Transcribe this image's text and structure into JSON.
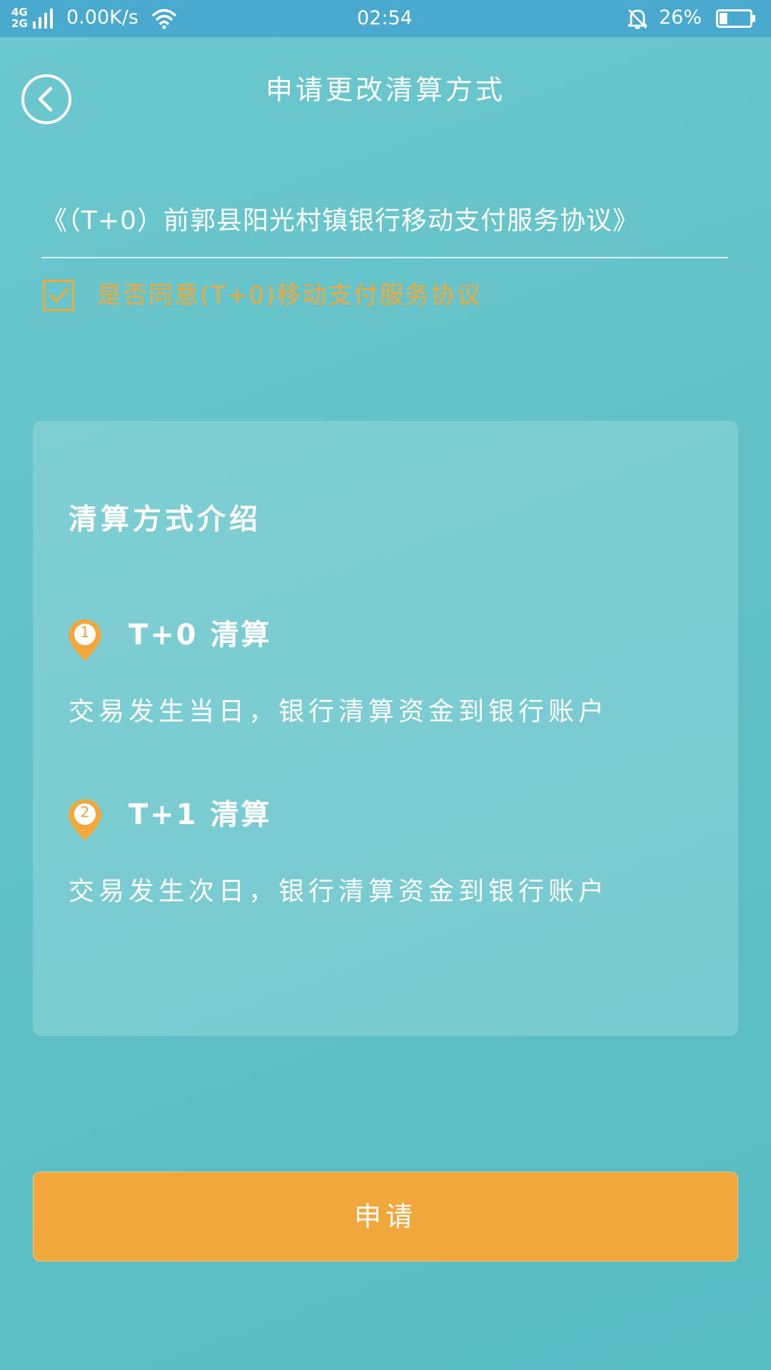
{
  "status_bar": {
    "network_top": "4G",
    "network_bottom": "2G",
    "speed": "0.00K/s",
    "time": "02:54",
    "battery": "26%",
    "battery_level": 0.26
  },
  "header": {
    "title": "申请更改清算方式"
  },
  "agreement": {
    "link_text": "《（T+0）前郭县阳光村镇银行移动支付服务协议》",
    "checkbox_label": "是否同意(T+0)移动支付服务协议",
    "checked": true
  },
  "info_card": {
    "title": "清算方式介绍",
    "options": [
      {
        "number": "1",
        "title": "T+0 清算",
        "description": "交易发生当日，银行清算资金到银行账户"
      },
      {
        "number": "2",
        "title": "T+1 清算",
        "description": "交易发生次日，银行清算资金到银行账户"
      }
    ]
  },
  "actions": {
    "apply_label": "申请"
  },
  "colors": {
    "status_bar": "#49a9cf",
    "background": "#63c2c8",
    "accent": "#f2a73c",
    "text": "#ffffff"
  },
  "icons": [
    "back-arrow-icon",
    "checkmark-icon",
    "location-pin-icon",
    "wifi-icon",
    "bell-icon",
    "battery-icon",
    "signal-icon"
  ]
}
